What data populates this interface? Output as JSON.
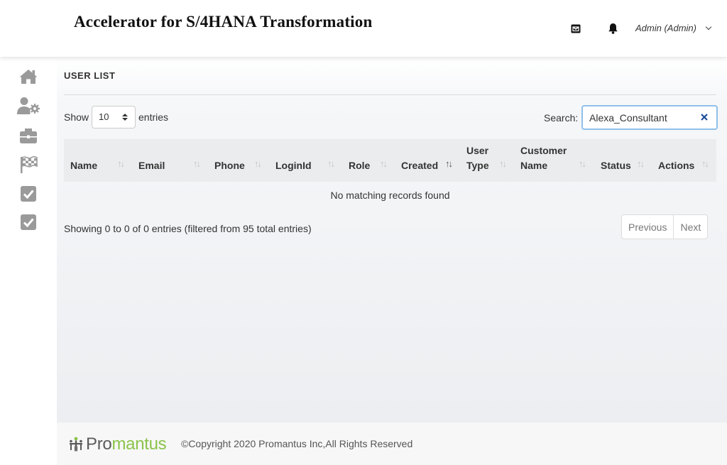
{
  "header": {
    "app_title": "Accelerator for S/4HANA Transformation",
    "user_label": "Admin (Admin)"
  },
  "sidebar": {
    "items": [
      {
        "icon": "home-icon"
      },
      {
        "icon": "user-settings-icon"
      },
      {
        "icon": "briefcase-icon"
      },
      {
        "icon": "checkered-flag-icon"
      },
      {
        "icon": "checkbox-icon"
      },
      {
        "icon": "checkbox-icon"
      }
    ]
  },
  "main": {
    "page_title": "USER LIST",
    "length": {
      "show_label": "Show",
      "value": "10",
      "entries_label": "entries"
    },
    "search": {
      "label": "Search:",
      "value": "Alexa_Consultant"
    },
    "table": {
      "columns": [
        {
          "line1": "",
          "line2": "Name"
        },
        {
          "line1": "",
          "line2": "Email"
        },
        {
          "line1": "",
          "line2": "Phone"
        },
        {
          "line1": "",
          "line2": "LoginId"
        },
        {
          "line1": "",
          "line2": "Role"
        },
        {
          "line1": "",
          "line2": "Created"
        },
        {
          "line1": "User",
          "line2": "Type"
        },
        {
          "line1": "Customer",
          "line2": "Name"
        },
        {
          "line1": "",
          "line2": "Status"
        },
        {
          "line1": "",
          "line2": "Actions"
        }
      ],
      "sorted_column": "Created",
      "empty_message": "No matching records found"
    },
    "info": "Showing 0 to 0 of 0 entries (filtered from 95 total entries)",
    "pagination": {
      "previous": "Previous",
      "next": "Next"
    }
  },
  "footer": {
    "logo_text_start": "Pro",
    "logo_text_end": "mantus",
    "copyright": "©Copyright 2020 Promantus Inc,All Rights Reserved"
  },
  "colors": {
    "icon_gray": "#9a9a9a",
    "logo_green": "#8bc34a",
    "table_header_bg": "#ebecee",
    "search_focus_border": "#8fc0ea"
  }
}
